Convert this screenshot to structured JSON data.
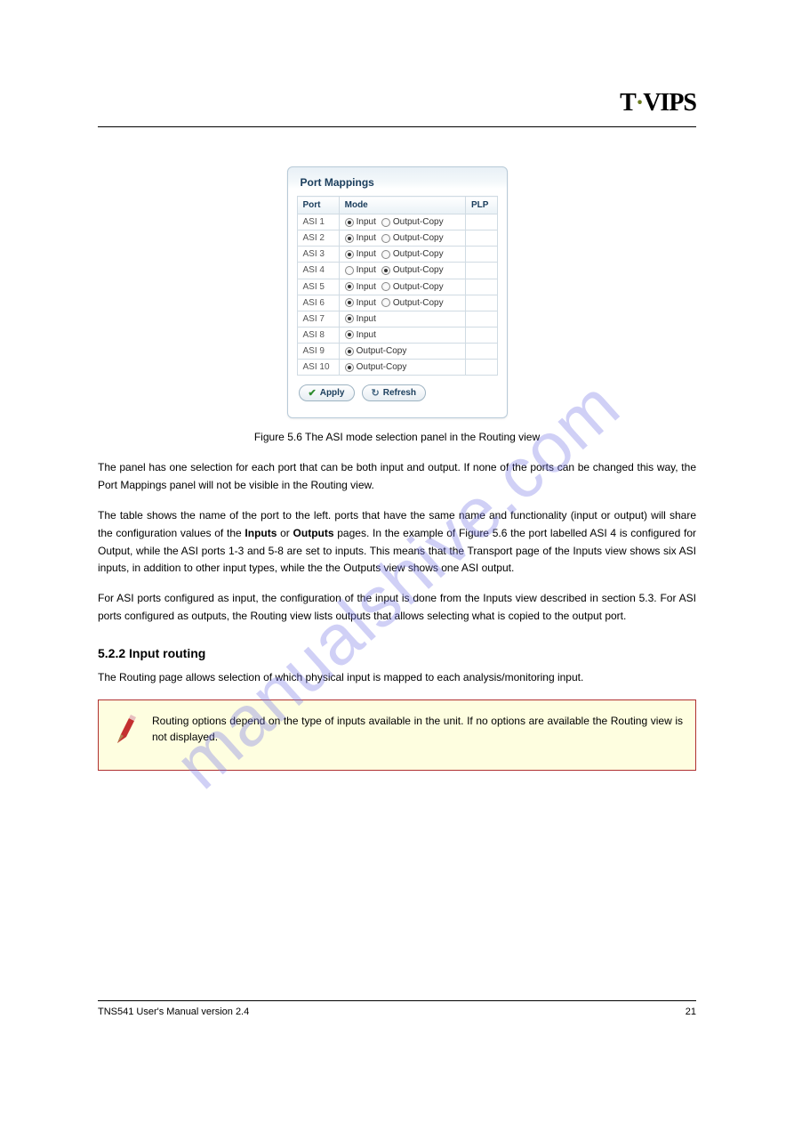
{
  "logo": {
    "pre": "T",
    "dot": "·",
    "post": "VIPS"
  },
  "watermark": "manualshive.com",
  "panel": {
    "title": "Port Mappings",
    "headers": {
      "port": "Port",
      "mode": "Mode",
      "plp": "PLP"
    },
    "rows": [
      {
        "port": "ASI 1",
        "input": "Input",
        "output": "Output-Copy",
        "sel": "input",
        "plp": ""
      },
      {
        "port": "ASI 2",
        "input": "Input",
        "output": "Output-Copy",
        "sel": "input",
        "plp": ""
      },
      {
        "port": "ASI 3",
        "input": "Input",
        "output": "Output-Copy",
        "sel": "input",
        "plp": ""
      },
      {
        "port": "ASI 4",
        "input": "Input",
        "output": "Output-Copy",
        "sel": "output",
        "plp": ""
      },
      {
        "port": "ASI 5",
        "input": "Input",
        "output": "Output-Copy",
        "sel": "input",
        "plp": ""
      },
      {
        "port": "ASI 6",
        "input": "Input",
        "output": "Output-Copy",
        "sel": "input",
        "plp": ""
      },
      {
        "port": "ASI 7",
        "input": "Input",
        "output": "",
        "sel": "input",
        "plp": ""
      },
      {
        "port": "ASI 8",
        "input": "Input",
        "output": "",
        "sel": "input",
        "plp": ""
      },
      {
        "port": "ASI 9",
        "input": "",
        "output": "Output-Copy",
        "sel": "output",
        "plp": ""
      },
      {
        "port": "ASI 10",
        "input": "",
        "output": "Output-Copy",
        "sel": "output",
        "plp": ""
      }
    ],
    "buttons": {
      "apply": "Apply",
      "refresh": "Refresh"
    }
  },
  "figure_caption": "Figure 5.6 The ASI mode selection panel in the Routing view",
  "paragraphs": {
    "p1": "The panel has one selection for each port that can be both input and output. If none of the ports can be changed this way, the Port Mappings panel will not be visible in the Routing view.",
    "p2_a": "The table shows the name of the port to the left. ports that have the same name and functionality (input or output) will share the configuration values of the ",
    "p2_b": "Inputs",
    "p2_c": " or ",
    "p2_d": "Outputs",
    "p2_e": " pages. In the example of Figure 5.6 the port labelled ASI 4 is configured for Output, while the ASI ports 1-3 and 5-8 are set to inputs. This means that the Transport page of the Inputs view shows six ASI inputs, in addition to other input types, while the the Outputs view shows one ASI output.",
    "p3": "For ASI ports configured as input, the configuration of the input is done from the Inputs view described in section 5.3. For ASI ports configured as outputs, the Routing view lists outputs that allows selecting what is copied to the output port."
  },
  "heading_5_2_2": "5.2.2 Input routing",
  "p4": "The Routing page allows selection of which physical input is mapped to each analysis/monitoring input.",
  "note_text": "Routing options depend on the type of inputs available in the unit. If no options are available the Routing view is not displayed.",
  "footer": {
    "left": "TNS541 User's Manual version 2.4",
    "right": "21"
  }
}
